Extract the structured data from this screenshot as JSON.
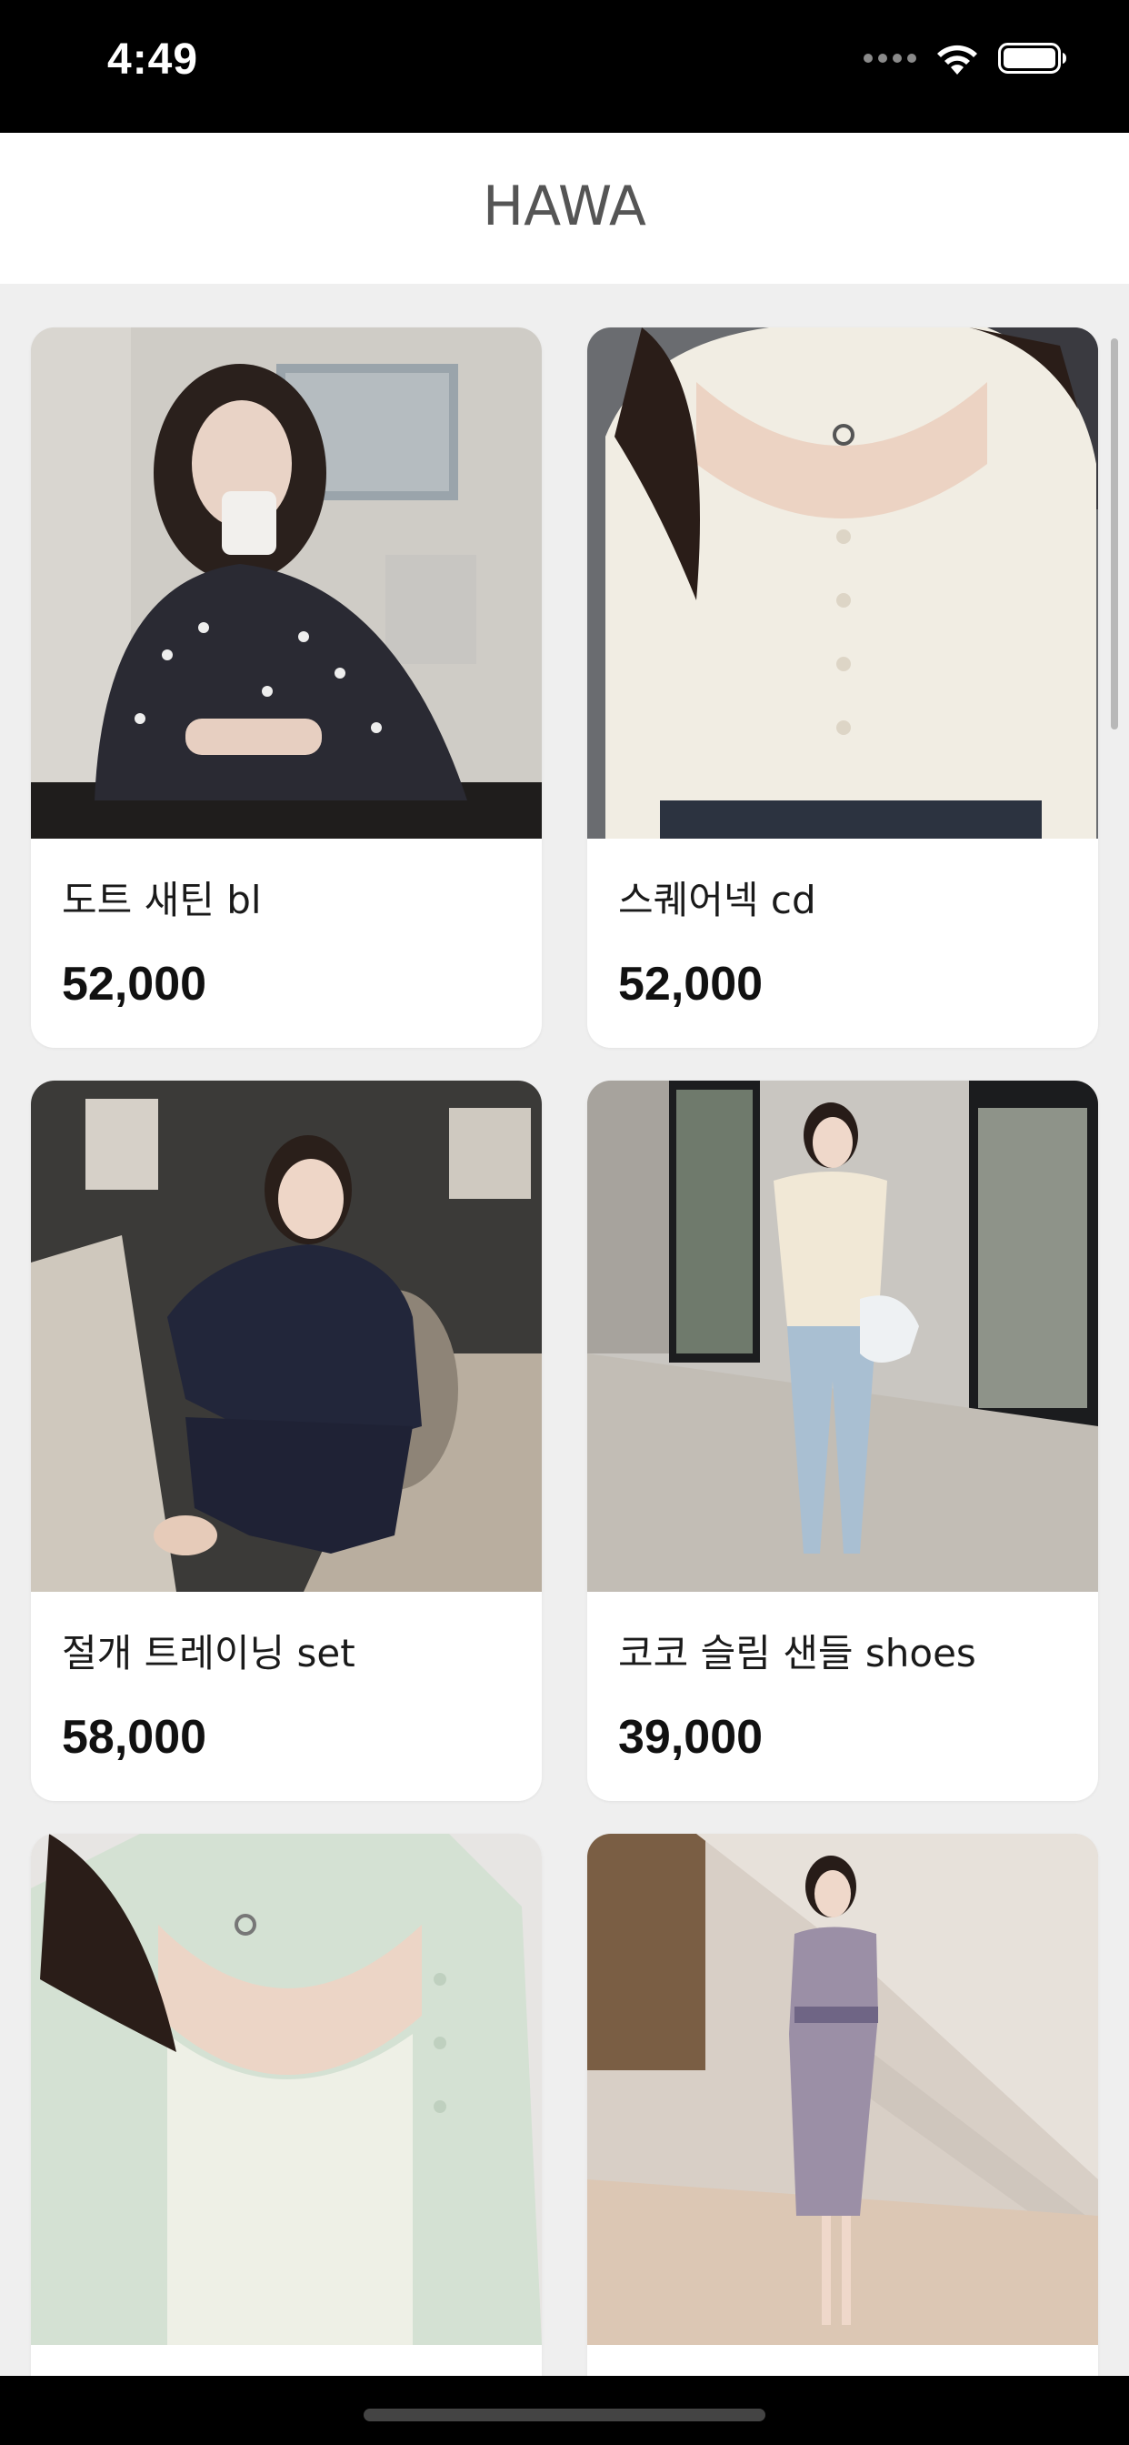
{
  "status_bar": {
    "time": "4:49",
    "icons": [
      "cellular-dots-icon",
      "wifi-icon",
      "battery-icon"
    ]
  },
  "nav": {
    "title": "HAWA"
  },
  "products": [
    {
      "name": "도트 새틴 bl",
      "price": "52,000"
    },
    {
      "name": "스퀘어넥 cd",
      "price": "52,000"
    },
    {
      "name": "절개 트레이닝 set",
      "price": "58,000"
    },
    {
      "name": "코코 슬림 샌들 shoes",
      "price": "39,000"
    },
    {
      "name": "",
      "price": ""
    },
    {
      "name": "",
      "price": ""
    }
  ],
  "colors": {
    "background": "#efefef",
    "card": "#ffffff",
    "text": "#111111"
  }
}
